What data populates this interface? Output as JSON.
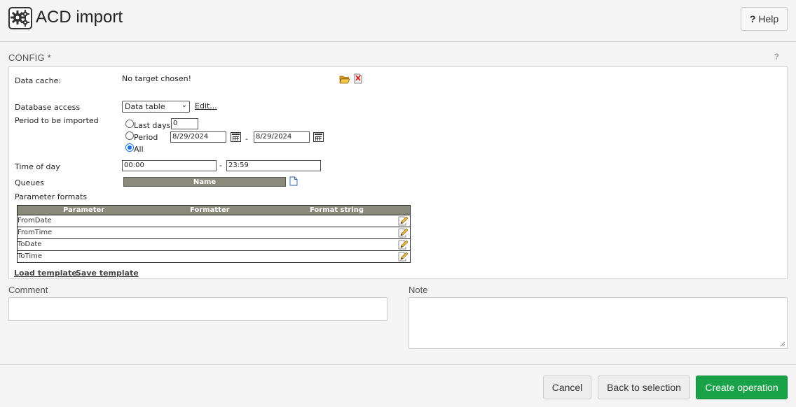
{
  "header": {
    "title": "ACD import",
    "help_label": "Help",
    "help_prefix": "?"
  },
  "config": {
    "section_label": "CONFIG *",
    "section_help": "?",
    "data_cache_label": "Data cache:",
    "data_cache_value": "No target chosen!",
    "database_access_label": "Database access",
    "database_access_selected": "Data table",
    "edit_link": "Edit...",
    "period_label": "Period to be imported",
    "radio_last_days": "Last days",
    "last_days_value": "0",
    "radio_period": "Period",
    "period_from": "8/29/2024",
    "period_separator": "-",
    "period_to": "8/29/2024",
    "radio_all": "All",
    "selected_radio": "All",
    "time_of_day_label": "Time of day",
    "time_from": "00:00",
    "time_separator": "-",
    "time_to": "23:59",
    "queues_label": "Queues",
    "queues_column": "Name",
    "parameter_formats_label": "Parameter formats",
    "param_columns": [
      "Parameter",
      "Formatter",
      "Format string"
    ],
    "param_rows": [
      "FromDate",
      "FromTime",
      "ToDate",
      "ToTime"
    ],
    "load_template": "Load template",
    "save_template": "Save template"
  },
  "comment": {
    "label": "Comment",
    "value": ""
  },
  "note": {
    "label": "Note",
    "value": ""
  },
  "footer": {
    "cancel_label": "Cancel",
    "back_label": "Back to selection",
    "create_label": "Create operation",
    "primary_color": "#1aa249"
  }
}
